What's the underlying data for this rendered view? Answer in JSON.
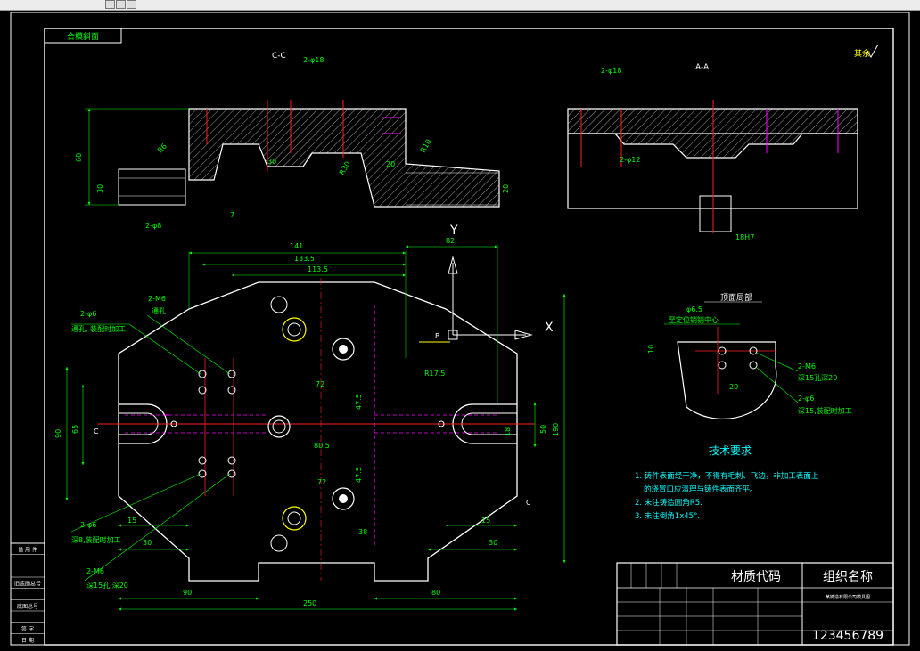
{
  "drawing": {
    "title_box": "合模斜面",
    "roughness_note": "其余",
    "section_cc": "C-C",
    "section_aa": "A-A",
    "axis_x": "X",
    "axis_y": "Y",
    "top_view_label": "B",
    "detail_title": "顶面局部",
    "detail_label_1": "至定位销销中心",
    "detail_label_2": "2-M6",
    "detail_label_3": "深15孔深20",
    "detail_label_4": "2-φ6",
    "detail_label_5": "深15,装配时加工",
    "left_note_1": "2-φ6",
    "left_note_2": "通孔, 装配时加工",
    "left_note_3": "2-M6",
    "left_note_4": "通孔",
    "left_note_5": "2-φ6",
    "left_note_6": "深8,装配时加工",
    "left_note_7": "2-M6",
    "left_note_8": "深15孔,深20",
    "right_note": "R17.5"
  },
  "dims": {
    "d141": "141",
    "d82": "82",
    "d1335": "133.5",
    "d1135": "113.5",
    "d72a": "72",
    "d72b": "72",
    "d475a": "47.5",
    "d475b": "47.5",
    "d805": "80.5",
    "d38": "38",
    "d15a": "15",
    "d15b": "15",
    "d30a": "30",
    "d30b": "30",
    "d90": "90",
    "d80": "80",
    "d250": "250",
    "d190": "190",
    "d90v": "90",
    "d65": "65",
    "d50": "50",
    "d18": "18",
    "d60": "60",
    "d30s": "30",
    "d20": "20",
    "d7": "7",
    "d2phi8": "2-φ8",
    "d2phi18": "2-φ18",
    "d2phi12": "2-φ12",
    "d18h7": "18H7",
    "d10": "10",
    "d65s": "φ6.5",
    "d20b": "20",
    "r6": "R6",
    "r30": "R30",
    "r20": "R20",
    "r10": "R10"
  },
  "requirements": {
    "heading": "技术要求",
    "line1": "1. 铸件表面经干净，不得有毛刺、飞边，非加工表面上",
    "line2": "的浇冒口应清理与铸件表面齐平。",
    "line3": "2. 未注铸造圆角R5.",
    "line4": "3. 未注倒角1x45°."
  },
  "title_block": {
    "material": "材质代码",
    "org": "组织名称",
    "drawing_no": "123456789",
    "small_note": "某铸造有限公司模具图"
  },
  "side_table": {
    "rows": [
      "借 用 件",
      "",
      "",
      "旧底图总号",
      "",
      "底图总号",
      "",
      "签 字",
      "日 期"
    ]
  },
  "colors": {
    "line_white": "#ffffff",
    "line_green": "#00ff00",
    "line_red": "#ff2020",
    "line_magenta": "#ff00ff",
    "line_yellow": "#ffff00",
    "text_cyan": "#00ffff",
    "background": "#000000"
  }
}
